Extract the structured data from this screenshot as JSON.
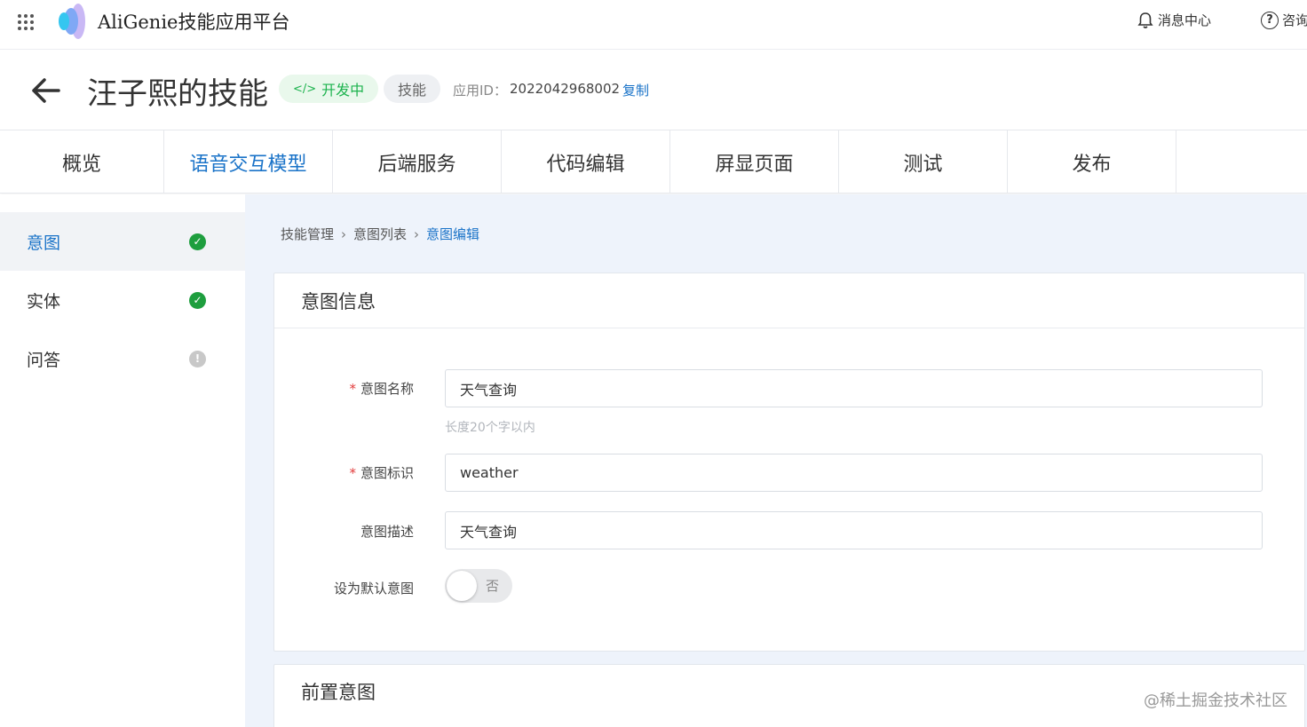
{
  "topbar": {
    "app_title": "AliGenie技能应用平台",
    "messages": "消息中心",
    "consult": "咨询"
  },
  "skill": {
    "name": "汪子熙的技能",
    "status": "开发中",
    "type": "技能",
    "app_id_label": "应用ID：",
    "app_id": "2022042968002",
    "copy": "复制"
  },
  "tabs": [
    {
      "label": "概览"
    },
    {
      "label": "语音交互模型"
    },
    {
      "label": "后端服务"
    },
    {
      "label": "代码编辑"
    },
    {
      "label": "屏显页面"
    },
    {
      "label": "测试"
    },
    {
      "label": "发布"
    }
  ],
  "sidebar": {
    "items": [
      {
        "label": "意图",
        "status": "complete"
      },
      {
        "label": "实体",
        "status": "complete"
      },
      {
        "label": "问答",
        "status": "warning"
      }
    ]
  },
  "breadcrumb": [
    "技能管理",
    "意图列表",
    "意图编辑"
  ],
  "intent_info": {
    "title": "意图信息",
    "name_label": "意图名称",
    "name_value": "天气查询",
    "name_hint": "长度20个字以内",
    "id_label": "意图标识",
    "id_value": "weather",
    "desc_label": "意图描述",
    "desc_value": "天气查询",
    "default_label": "设为默认意图",
    "default_value": "否"
  },
  "pre_intent": {
    "title": "前置意图"
  },
  "watermark": "@稀土掘金技术社区",
  "colors": {
    "accent": "#1a73c8",
    "success": "#1e9e3e",
    "status_green": "#1db34e",
    "required": "#e23b3b"
  }
}
